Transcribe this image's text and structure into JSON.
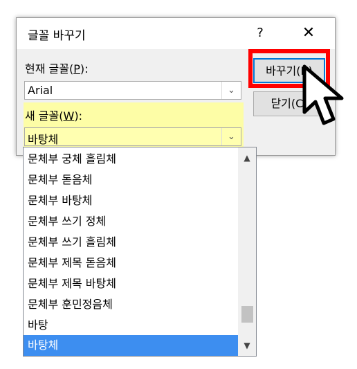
{
  "dialog": {
    "title": "글꼴 바꾸기",
    "help_glyph": "?",
    "close_glyph": "✕",
    "current_font": {
      "label_prefix": "현재 글꼴(",
      "label_key": "P",
      "label_suffix": "):",
      "value": "Arial"
    },
    "new_font": {
      "label_prefix": "새 글꼴(",
      "label_key": "W",
      "label_suffix": "):",
      "value": "바탕체"
    },
    "replace_button": "바꾸기(R)",
    "close_button": "닫기(C)"
  },
  "font_list": {
    "items": [
      "문체부 궁체 흘림체",
      "문체부 돋음체",
      "문체부 바탕체",
      "문체부 쓰기 정체",
      "문체부 쓰기 흘림체",
      "문체부 제목 돋음체",
      "문체부 제목 바탕체",
      "문체부 훈민정음체",
      "바탕",
      "바탕체"
    ],
    "selected_index": 9
  },
  "colors": {
    "highlight": "#ffff99",
    "selection": "#3d8ef0",
    "callout": "#ff0000",
    "focus_border": "#0078d7"
  },
  "icons": {
    "dropdown": "chevron-down-icon",
    "scroll_up": "chevron-up-icon",
    "scroll_down": "chevron-down-icon",
    "cursor": "mouse-pointer-icon"
  }
}
